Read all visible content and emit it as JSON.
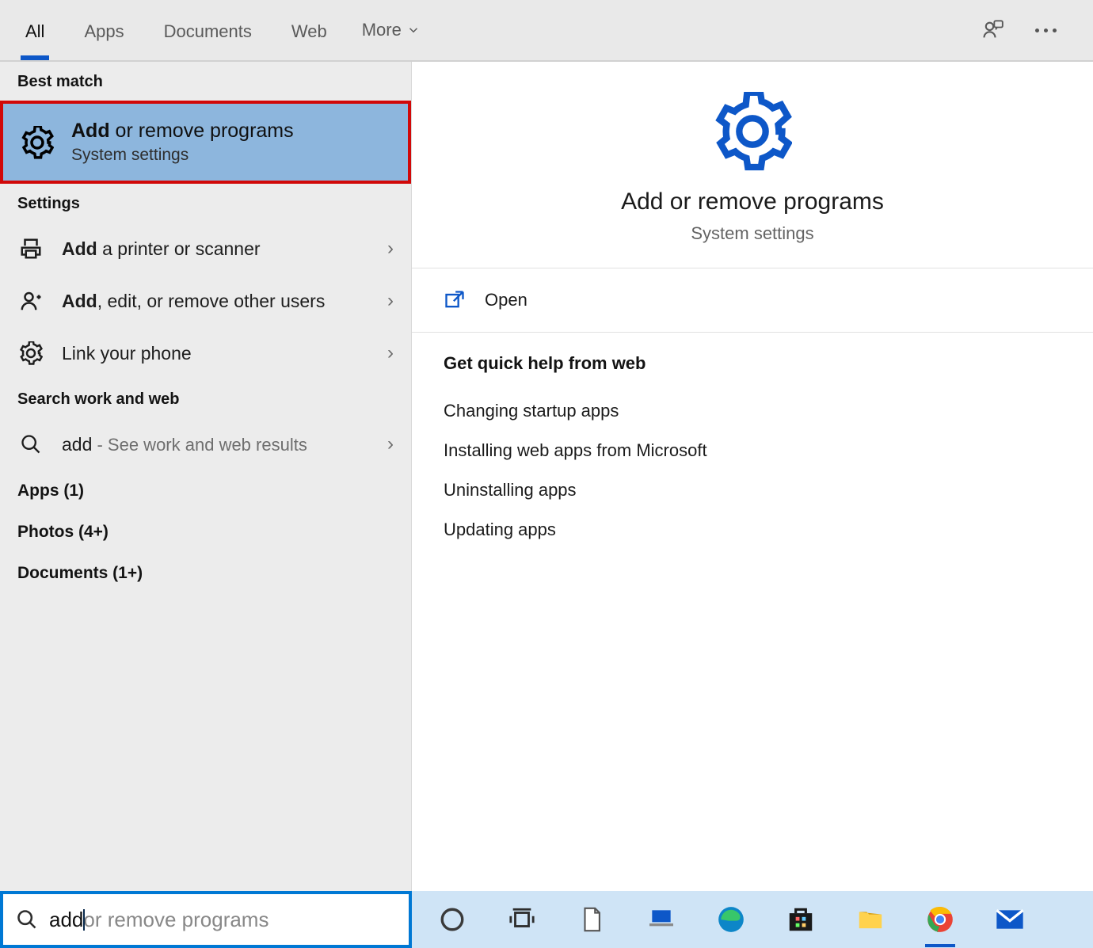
{
  "topbar": {
    "tabs": [
      "All",
      "Apps",
      "Documents",
      "Web",
      "More"
    ],
    "active_index": 0
  },
  "left": {
    "best_match_header": "Best match",
    "best_match": {
      "title_bold": "Add",
      "title_rest": " or remove programs",
      "subtitle": "System settings"
    },
    "settings_header": "Settings",
    "settings_items": [
      {
        "bold": "Add",
        "rest": " a printer or scanner",
        "icon": "printer"
      },
      {
        "bold": "Add",
        "rest": ", edit, or remove other users",
        "icon": "user-plus"
      },
      {
        "bold": "",
        "rest": "Link your phone",
        "icon": "gear"
      }
    ],
    "web_header": "Search work and web",
    "web_item": {
      "term": "add",
      "suffix": " - See work and web results"
    },
    "counts": [
      "Apps (1)",
      "Photos (4+)",
      "Documents (1+)"
    ]
  },
  "right": {
    "title": "Add or remove programs",
    "subtitle": "System settings",
    "open_label": "Open",
    "help_header": "Get quick help from web",
    "help_links": [
      "Changing startup apps",
      "Installing web apps from Microsoft",
      "Uninstalling apps",
      "Updating apps"
    ]
  },
  "search": {
    "typed": "add",
    "ghost": " or remove programs"
  },
  "taskbar_items": [
    "cortana",
    "task-view",
    "document",
    "laptop",
    "edge",
    "store",
    "file-explorer",
    "chrome",
    "mail"
  ],
  "taskbar_active_index": 7
}
